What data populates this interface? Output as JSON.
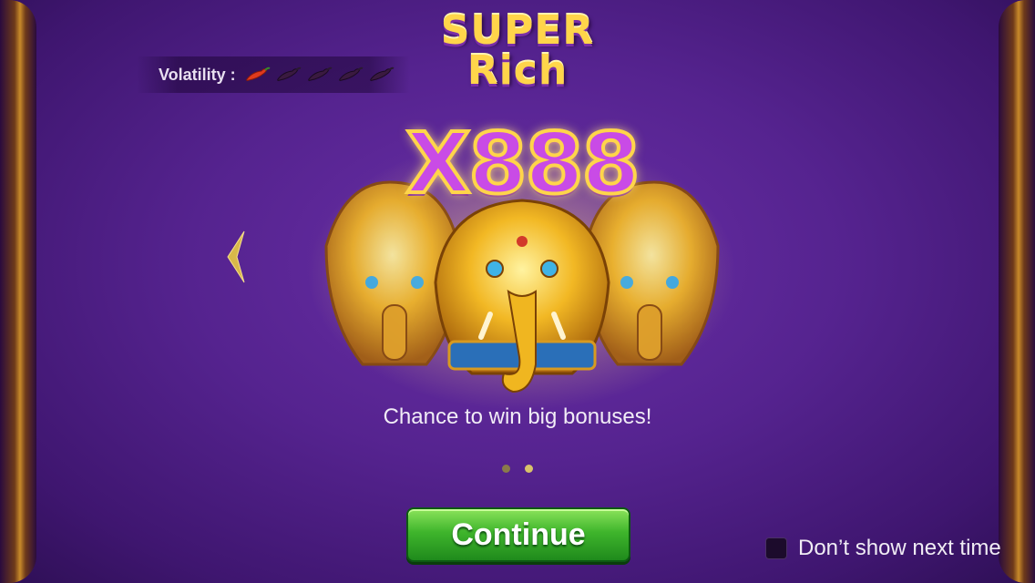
{
  "logo": {
    "line1": "SUPER",
    "line2": "Rich"
  },
  "volatility": {
    "label": "Volatility :",
    "level": 1,
    "max": 5,
    "active_color": "#e03a1e",
    "inactive_color": "#3a1a40"
  },
  "promo": {
    "multiplier": "X888",
    "caption": "Chance to win big bonuses!"
  },
  "pagination": {
    "total": 2,
    "current": 2
  },
  "buttons": {
    "continue_label": "Continue"
  },
  "dont_show": {
    "label": "Don’t show next time",
    "checked": false
  },
  "colors": {
    "background": "#55238f",
    "button_green": "#3fb52c",
    "gold": "#ffd54a"
  }
}
